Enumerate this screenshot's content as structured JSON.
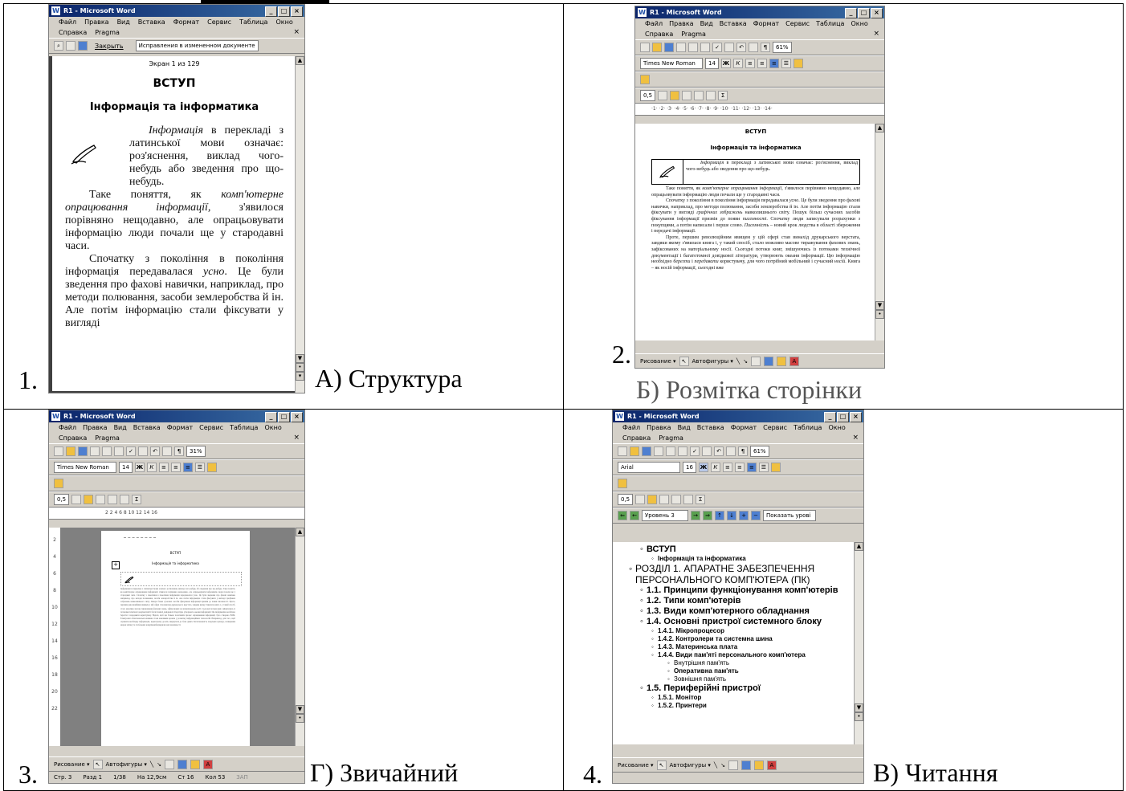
{
  "cells": {
    "c1": {
      "number": "1.",
      "caption": "А) Структура"
    },
    "c2": {
      "number": "2.",
      "caption": "Б) Розмітка сторінки"
    },
    "c3": {
      "number": "3.",
      "caption": "Г) Звичайний"
    },
    "c4": {
      "number": "4.",
      "caption": "В) Читання"
    }
  },
  "word": {
    "title": "R1 - Microsoft Word",
    "menu1": [
      "Файл",
      "Правка",
      "Вид",
      "Вставка",
      "Формат",
      "Сервис",
      "Таблица",
      "Окно"
    ],
    "menu2": [
      "Справка",
      "Pragma"
    ],
    "close_doc": "×",
    "font_tnr": "Times New Roman",
    "font_arial": "Arial",
    "size14": "14",
    "size16": "16",
    "zoom61": "61%",
    "zoom31": "31%",
    "pt": "0,5",
    "draw": "Рисование ▾",
    "autoshapes": "Автофигуры ▾"
  },
  "w1": {
    "close_btn": "Закрыть",
    "track_combo": "Исправления в измененном документе",
    "screen_label": "Экран 1 из 129",
    "heading": "ВСТУП",
    "subheading": "Інформація та інформатика",
    "p1_em": "Інформація",
    "p1_rest": " в перекладі з латинської мови означає: роз'яснення, виклад чого-небудь або зведення про що-небудь.",
    "p2_a": "Таке поняття, як ",
    "p2_em": "комп'ютерне опрацювання інформації,",
    "p2_b": " з'явилося порівняно нещодавно, але опрацьовувати інформацію люди почали ще у стародавні часи.",
    "p3_a": "Спочатку з покоління в покоління інформація передавалася ",
    "p3_em": "усно",
    "p3_b": ". Це були зведення про фахові навички, наприклад, про методи полювання, засоби землеробства й ін. Але потім інформацію стали фіксувати у вигляді"
  },
  "w2": {
    "ruler": "·1·  ·2·  ·3·  ·4·  ·5·  ·6·  ·7·  ·8·  ·9·  ·10·  ·11·  ·12·  ·13·  ·14·",
    "heading": "ВСТУП",
    "subheading": "Інформація та інформатика",
    "p1_em": "Інформація",
    "p1_rest": " в перекладі з латинської мови означає: роз'яснення, виклад чого-небудь або зведення про що-небудь.",
    "p2_a": "Таке поняття, як ",
    "p2_em": "комп'ютерне опрацювання інформації,",
    "p2_b": " з'явилося порівняно нещодавно, але опрацьовувати інформацію люди почали ще у стародавні часи.",
    "p3_a": "Спочатку з покоління в покоління інформація передавалася ",
    "p3_em": "усно",
    "p3_b": ". Це були зведення про фахові навички, наприклад, про методи полювання, засоби землеробства й ін. Але потім інформацію стали фіксувати у вигляді ",
    "p3_em2": "графічних зображень",
    "p3_c": " навколишнього світу. Пошук більш сучасних засобів фіксування інформації призвів до появи ",
    "p3_em3": "писемності",
    "p3_d": ". Спочатку люди записували розрахунки з покупцями, а потім написали і перше слово. ",
    "p3_em4": "Писемність",
    "p3_e": " – новий крок людства в області збереження і передачі інформації.",
    "p4": "Проте, першим революційним явищем у цій сфері став винахід друкарського верстата, завдяки якому з'явилася книга і, у такий спосіб, стало можливо масове тиражування фахових знань, зафіксованих на матеріальному носії. Сьогодні потоки книг, змішуючись із потоками технічної документації і багатотомної довідкової літератури, утворюють океани інформації. Цю інформацію необхідно ",
    "p4_em": "берегти",
    "p4_b": " і ",
    "p4_em2": "передавати",
    "p4_c": " користувачу, для чого потрібний мобільний і сучасний ",
    "p4_em3": "носій",
    "p4_d": ". Книга – як носій інформації, сьогодні вже"
  },
  "w3": {
    "ruler": "2      2    4    6    8    10    12    14   16",
    "left_ruler": [
      "2",
      "4",
      "6",
      "8",
      "10",
      "12",
      "14",
      "16",
      "18",
      "20",
      "22"
    ],
    "heading": "ВСТУП",
    "subheading": "Інформація та інформатика",
    "body": "Інформація в перекладі з латинської мови означає: роз'яснення, виклад чого-небудь або зведення про що-небудь. Таке поняття, як комп'ютерне опрацювання інформації, з'явилося порівняно нещодавно, але опрацьовувати інформацію люди почали ще у стародавні часи. Спочатку з покоління в покоління інформація передавалася усно. Це були зведення про фахові навички, наприклад, про методи полювання, засоби землеробства й ін. Але потім інформацію стали фіксувати у вигляді графічних зображень навколишнього світу. Пошук більш сучасних засобів фіксування інформації призвів до появи писемності. Проте, першим революційним явищем у цій сфері став винахід друкарського верстата, завдяки якому з'явилася книга і, у такий спосіб, стало можливо масове тиражування фахових знань, зафіксованих на матеріальному носії. Сьогодні потоки книг, змішуючись із потоками технічної документації і багатотомної довідкової літератури, утворюють океани інформації. Цю інформацію необхідно берегти і передавати користувачу. Надалі, щоб ще більше полегшити процес опрацювання інформації, було створено ЕОМ. Електронні обчислювальні машини стали важливим кроком у розвитку інформаційних технологій. Наприклад, для того, щоб отримати необхідну інформацію, користувачу досить звернутися до бази даних. Багатомовність людських культур, поширення мереж зв'язку та глобальних комунікацій відкрили нові можливості.",
    "status": [
      "Стр. 3",
      "Разд 1",
      "1/38",
      "На 12,9см",
      "Ст 16",
      "Кол 53",
      "ЗАП"
    ]
  },
  "w4": {
    "level_combo": "Уровень 3",
    "show_combo": "Показать урові",
    "items": [
      {
        "text": "ВСТУП",
        "level": 1,
        "bold": true
      },
      {
        "text": "Інформація та інформатика",
        "level": 2,
        "bold": true
      },
      {
        "text": "РОЗДІЛ 1. АПАРАТНЕ ЗАБЕЗПЕЧЕННЯ ПЕРСОНАЛЬНОГО КОМП'ЮТЕРА (ПК)",
        "level": 0,
        "bold": false
      },
      {
        "text": "1.1. Принципи функціонування комп'ютерів",
        "level": 1,
        "bold": true
      },
      {
        "text": "1.2. Типи комп'ютерів",
        "level": 1,
        "bold": true
      },
      {
        "text": "1.3. Види комп'ютерного обладнання",
        "level": 1,
        "bold": true
      },
      {
        "text": "1.4. Основні пристрої системного блоку",
        "level": 1,
        "bold": true
      },
      {
        "text": "1.4.1. Мікропроцесор",
        "level": 2,
        "bold": true
      },
      {
        "text": "1.4.2. Контролери та системна шина",
        "level": 2,
        "bold": true
      },
      {
        "text": "1.4.3. Материнська плата",
        "level": 2,
        "bold": true
      },
      {
        "text": "1.4.4. Види пам'яті персонального комп'ютера",
        "level": 2,
        "bold": true
      },
      {
        "text": "Внутрішня пам'ять",
        "level": 3,
        "bold": false
      },
      {
        "text": "Оперативна пам'ять",
        "level": 3,
        "bold": true
      },
      {
        "text": "Зовнішня пам'ять",
        "level": 3,
        "bold": false
      },
      {
        "text": "1.5. Периферійні пристрої",
        "level": 1,
        "bold": true
      },
      {
        "text": "1.5.1. Монітор",
        "level": 2,
        "bold": true
      },
      {
        "text": "1.5.2. Принтери",
        "level": 2,
        "bold": true
      }
    ]
  }
}
